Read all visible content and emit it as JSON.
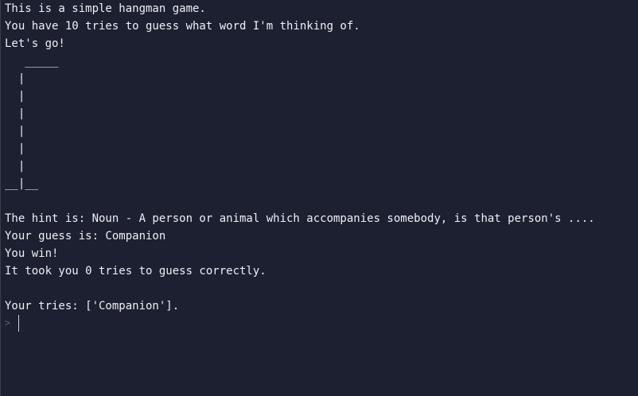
{
  "terminal": {
    "lines": [
      "This is a simple hangman game.",
      "You have 10 tries to guess what word I'm thinking of.",
      "Let's go!",
      "   _____",
      "  |",
      "  |",
      "  |",
      "  |",
      "  |",
      "  |",
      "__|__",
      "",
      "The hint is: Noun - A person or animal which accompanies somebody, is that person's ....",
      "Your guess is: Companion",
      "You win!",
      "It took you 0 tries to guess correctly.",
      "",
      "Your tries: ['Companion']."
    ],
    "prompt_symbol": ">",
    "input_value": ""
  }
}
